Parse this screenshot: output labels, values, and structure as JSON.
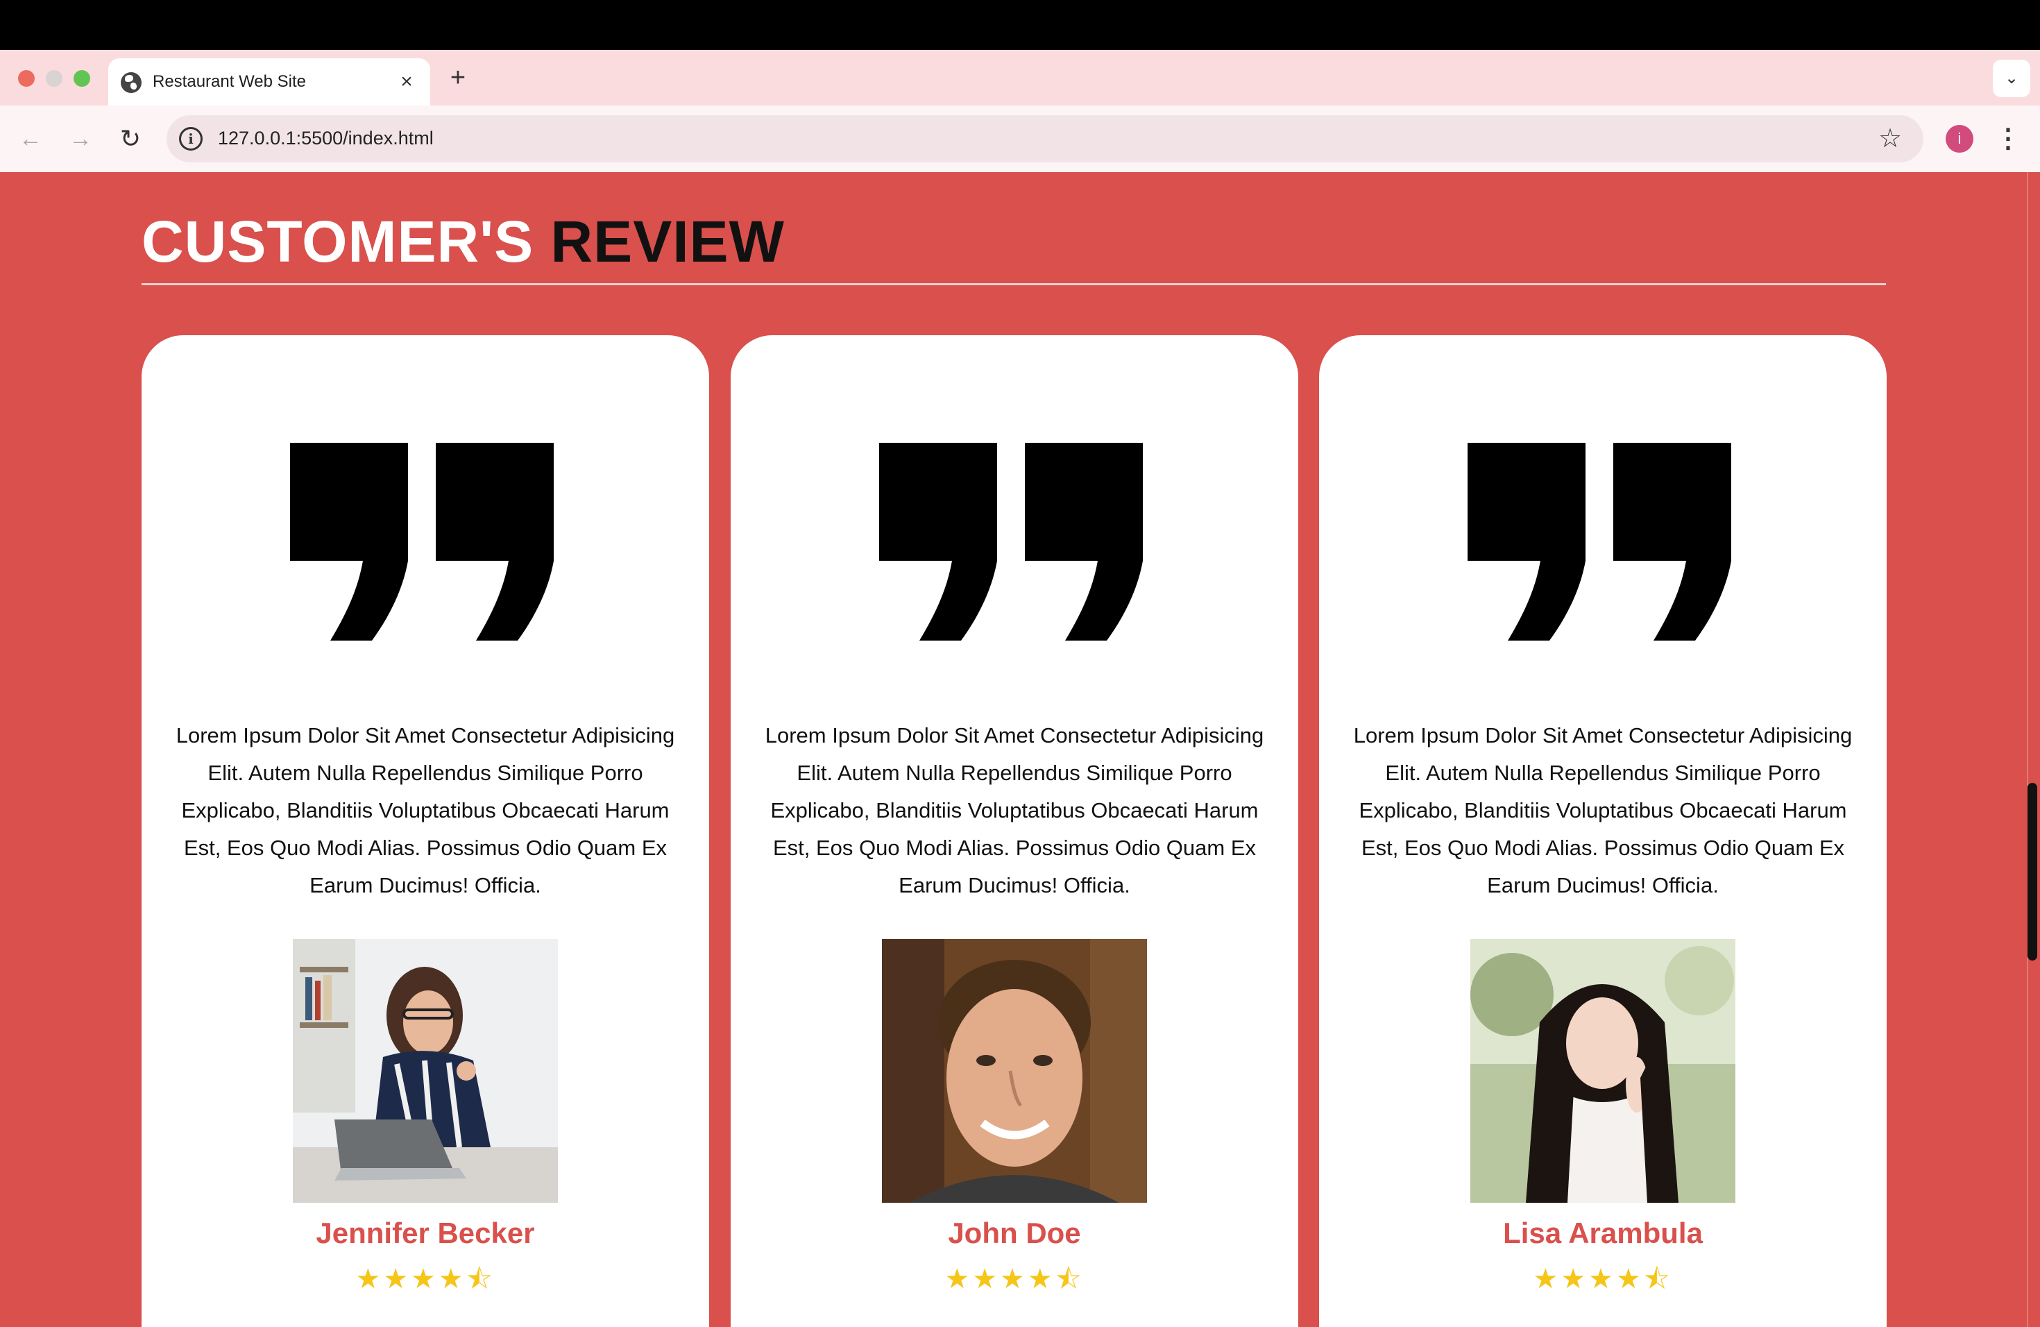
{
  "browser": {
    "tab_title": "Restaurant Web Site",
    "tab_close": "×",
    "new_tab": "+",
    "tab_menu": "⌄",
    "url": "127.0.0.1:5500/index.html",
    "info_glyph": "i",
    "profile_initial": "i",
    "back": "←",
    "forward": "→",
    "reload": "↻",
    "bookmark": "☆",
    "menu": "⋮"
  },
  "section": {
    "heading_part1": "CUSTOMER'S",
    "heading_part2": "REVIEW"
  },
  "reviews": [
    {
      "text": "Lorem Ipsum Dolor Sit Amet Consectetur Adipisicing Elit. Autem Nulla Repellendus Similique Porro Explicabo, Blanditiis Voluptatibus Obcaecati Harum Est, Eos Quo Modi Alias. Possimus Odio Quam Ex Earum Ducimus! Officia.",
      "name": "Jennifer Becker",
      "rating": 4.5,
      "stars": "★★★★⯪"
    },
    {
      "text": "Lorem Ipsum Dolor Sit Amet Consectetur Adipisicing Elit. Autem Nulla Repellendus Similique Porro Explicabo, Blanditiis Voluptatibus Obcaecati Harum Est, Eos Quo Modi Alias. Possimus Odio Quam Ex Earum Ducimus! Officia.",
      "name": "John Doe",
      "rating": 4.5,
      "stars": "★★★★⯪"
    },
    {
      "text": "Lorem Ipsum Dolor Sit Amet Consectetur Adipisicing Elit. Autem Nulla Repellendus Similique Porro Explicabo, Blanditiis Voluptatibus Obcaecati Harum Est, Eos Quo Modi Alias. Possimus Odio Quam Ex Earum Ducimus! Officia.",
      "name": "Lisa Arambula",
      "rating": 4.5,
      "stars": "★★★★⯪"
    }
  ],
  "colors": {
    "page_background": "#d9504c",
    "accent_name": "#d9504c",
    "star": "#f5c518"
  }
}
